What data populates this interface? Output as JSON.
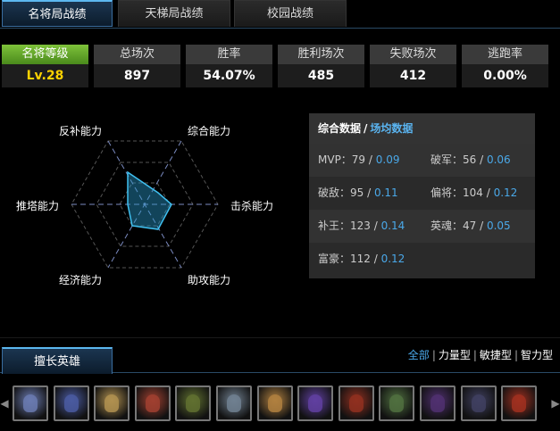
{
  "tabs": [
    {
      "label": "名将局战绩",
      "active": true
    },
    {
      "label": "天梯局战绩",
      "active": false
    },
    {
      "label": "校园战绩",
      "active": false
    }
  ],
  "stats": [
    {
      "label": "名将等级",
      "value": "Lv.28"
    },
    {
      "label": "总场次",
      "value": "897"
    },
    {
      "label": "胜率",
      "value": "54.07%"
    },
    {
      "label": "胜利场次",
      "value": "485"
    },
    {
      "label": "失败场次",
      "value": "412"
    },
    {
      "label": "逃跑率",
      "value": "0.00%"
    }
  ],
  "radar": {
    "labels": {
      "top_left": "反补能力",
      "top_right": "综合能力",
      "right": "击杀能力",
      "bottom_right": "助攻能力",
      "bottom_left": "经济能力",
      "left": "推塔能力"
    }
  },
  "panel": {
    "tab_total": "综合数据",
    "separator": "/",
    "tab_avg": "场均数据",
    "rows": [
      [
        {
          "name": "MVP：79 /",
          "avg": "0.09"
        },
        {
          "name": "破军：56 /",
          "avg": "0.06"
        }
      ],
      [
        {
          "name": "破敌：95 /",
          "avg": "0.11"
        },
        {
          "name": "偏将：104 /",
          "avg": "0.12"
        }
      ],
      [
        {
          "name": "补王：123 /",
          "avg": "0.14"
        },
        {
          "name": "英魂：47 /",
          "avg": "0.05"
        }
      ],
      [
        {
          "name": "富豪：112 /",
          "avg": "0.12"
        }
      ]
    ]
  },
  "hero_section": {
    "tab": "擅长英雄",
    "filters": [
      "全部",
      "力量型",
      "敏捷型",
      "智力型"
    ],
    "filter_sep": "|",
    "arrow_left": "◀",
    "arrow_right": "▶",
    "heroes": [
      {
        "icon": "hero-wizard-icon",
        "color": "#6a7ab0"
      },
      {
        "icon": "hero-undead-icon",
        "color": "#4a5aa0"
      },
      {
        "icon": "hero-dwarf-icon",
        "color": "#b09050"
      },
      {
        "icon": "hero-troll-icon",
        "color": "#a04030"
      },
      {
        "icon": "hero-orc-icon",
        "color": "#607030"
      },
      {
        "icon": "hero-elf-icon",
        "color": "#708090"
      },
      {
        "icon": "hero-monk-icon",
        "color": "#b08040"
      },
      {
        "icon": "hero-mage-icon",
        "color": "#6040a0"
      },
      {
        "icon": "hero-demon-icon",
        "color": "#903020"
      },
      {
        "icon": "hero-beast-icon",
        "color": "#507040"
      },
      {
        "icon": "hero-shadow-icon",
        "color": "#503070"
      },
      {
        "icon": "hero-knight-icon",
        "color": "#404060"
      },
      {
        "icon": "hero-fiend-icon",
        "color": "#a03020"
      }
    ]
  }
}
